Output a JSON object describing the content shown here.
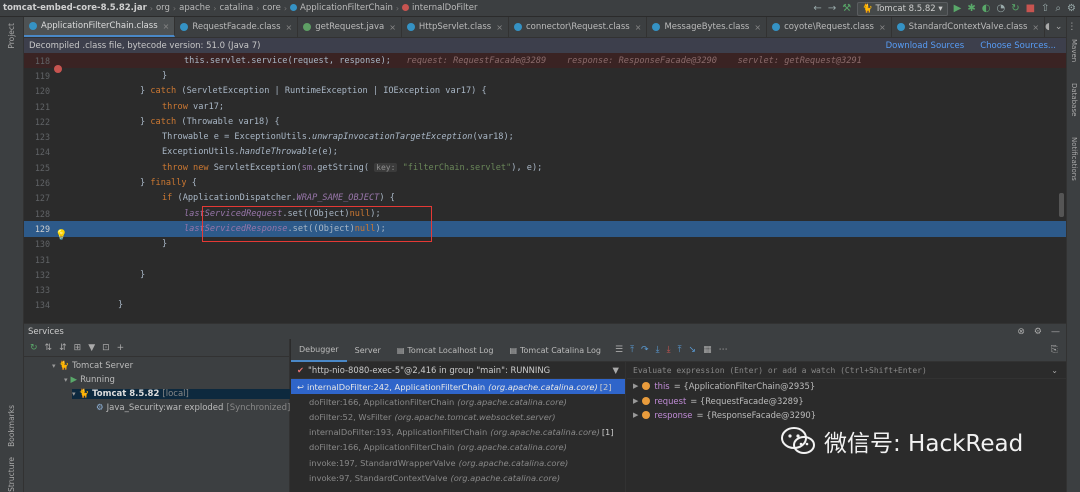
{
  "nav": {
    "project": "tomcat-embed-core-8.5.82.jar",
    "crumbs": [
      "org",
      "apache",
      "catalina",
      "core",
      "ApplicationFilterChain",
      "internalDoFilter"
    ],
    "run_config": "Tomcat 8.5.82"
  },
  "tabs": [
    {
      "label": "ApplicationFilterChain.class",
      "active": true
    },
    {
      "label": "RequestFacade.class"
    },
    {
      "label": "getRequest.java"
    },
    {
      "label": "HttpServlet.class"
    },
    {
      "label": "connector\\Request.class"
    },
    {
      "label": "MessageBytes.class"
    },
    {
      "label": "coyote\\Request.class"
    },
    {
      "label": "StandardContextValve.class"
    }
  ],
  "banner": {
    "text": "Decompiled .class file, bytecode version: 51.0 (Java 7)",
    "download": "Download Sources",
    "choose": "Choose Sources..."
  },
  "side": {
    "project": "Project",
    "bookmarks": "Bookmarks",
    "structure": "Structure",
    "maven": "Maven",
    "database": "Database",
    "notifications": "Notifications"
  },
  "editor": {
    "lines": [
      {
        "n": "118",
        "code": "this.servlet.service(request, response);",
        "hint": "request: RequestFacade@3289    response: ResponseFacade@3290    servlet: getRequest@3291"
      },
      {
        "n": "119",
        "code": "}"
      },
      {
        "n": "120",
        "code": "} catch (ServletException | RuntimeException | IOException var17) {"
      },
      {
        "n": "121",
        "code": "throw var17;"
      },
      {
        "n": "122",
        "code": "} catch (Throwable var18) {"
      },
      {
        "n": "123",
        "code": "Throwable e = ExceptionUtils.unwrapInvocationTargetException(var18);"
      },
      {
        "n": "124",
        "code": "ExceptionUtils.handleThrowable(e);"
      },
      {
        "n": "125",
        "code": "throw new ServletException(sm.getString( key: \"filterChain.servlet\"), e);"
      },
      {
        "n": "126",
        "code": "} finally {"
      },
      {
        "n": "127",
        "code": "if (ApplicationDispatcher.WRAP_SAME_OBJECT) {"
      },
      {
        "n": "128",
        "code": "lastServicedRequest.set((Object)null);"
      },
      {
        "n": "129",
        "code": "lastServicedResponse.set((Object)null);"
      },
      {
        "n": "130",
        "code": "}"
      },
      {
        "n": "131",
        "code": ""
      },
      {
        "n": "132",
        "code": "}"
      },
      {
        "n": "133",
        "code": ""
      },
      {
        "n": "134",
        "code": "}"
      },
      {
        "n": "135",
        "code": ""
      }
    ]
  },
  "services": {
    "title": "Services",
    "tree": {
      "server": "Tomcat Server",
      "running": "Running",
      "instance": "Tomcat 8.5.82",
      "instance_tag": "[local]",
      "artifact": "Java_Security:war exploded",
      "artifact_status": "[Synchronized]"
    }
  },
  "debugger": {
    "tabs": [
      "Debugger",
      "Server",
      "Tomcat Localhost Log",
      "Tomcat Catalina Log"
    ],
    "thread": "\"http-nio-8080-exec-5\"@2,416 in group \"main\": RUNNING",
    "frames": [
      {
        "method": "internalDoFilter:242, ApplicationFilterChain",
        "pkg": "(org.apache.catalina.core)",
        "count": "[2]",
        "selected": true
      },
      {
        "method": "doFilter:166, ApplicationFilterChain",
        "pkg": "(org.apache.catalina.core)"
      },
      {
        "method": "doFilter:52, WsFilter",
        "pkg": "(org.apache.tomcat.websocket.server)"
      },
      {
        "method": "internalDoFilter:193, ApplicationFilterChain",
        "pkg": "(org.apache.catalina.core)",
        "count": "[1]"
      },
      {
        "method": "doFilter:166, ApplicationFilterChain",
        "pkg": "(org.apache.catalina.core)"
      },
      {
        "method": "invoke:197, StandardWrapperValve",
        "pkg": "(org.apache.catalina.core)"
      },
      {
        "method": "invoke:97, StandardContextValve",
        "pkg": "(org.apache.catalina.core)"
      }
    ],
    "eval_placeholder": "Evaluate expression (Enter) or add a watch (Ctrl+Shift+Enter)",
    "variables": [
      {
        "name": "this",
        "value": "= {ApplicationFilterChain@2935}"
      },
      {
        "name": "request",
        "value": "= {RequestFacade@3289}"
      },
      {
        "name": "response",
        "value": "= {ResponseFacade@3290}"
      }
    ]
  },
  "watermark": {
    "text": "微信号: HackRead"
  },
  "colors": {
    "selection": "#2d5a8a",
    "highlight_box": "#e53935",
    "accent": "#4a88c7"
  }
}
